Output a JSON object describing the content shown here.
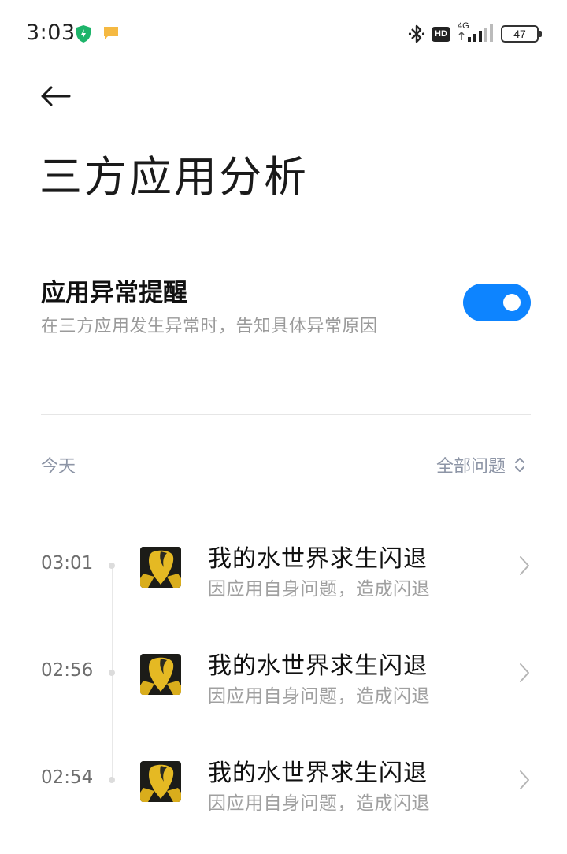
{
  "status_bar": {
    "time": "3:03",
    "network": "4G",
    "hd": "HD",
    "battery": "47"
  },
  "header": {
    "title": "三方应用分析"
  },
  "setting": {
    "title": "应用异常提醒",
    "description": "在三方应用发生异常时，告知具体异常原因",
    "enabled": true
  },
  "filter": {
    "date_label": "今天",
    "filter_label": "全部问题"
  },
  "events": [
    {
      "time": "03:01",
      "title": "我的水世界求生闪退",
      "subtitle": "因应用自身问题，造成闪退"
    },
    {
      "time": "02:56",
      "title": "我的水世界求生闪退",
      "subtitle": "因应用自身问题，造成闪退"
    },
    {
      "time": "02:54",
      "title": "我的水世界求生闪退",
      "subtitle": "因应用自身问题，造成闪退"
    }
  ],
  "colors": {
    "accent": "#0d84ff",
    "muted_label": "#8d95a6",
    "secondary_text": "#a0a0a0"
  },
  "icons": {
    "back": "arrow-left-icon",
    "filter": "chevron-updown-icon",
    "row": "chevron-right-icon",
    "app": "app-icon"
  }
}
